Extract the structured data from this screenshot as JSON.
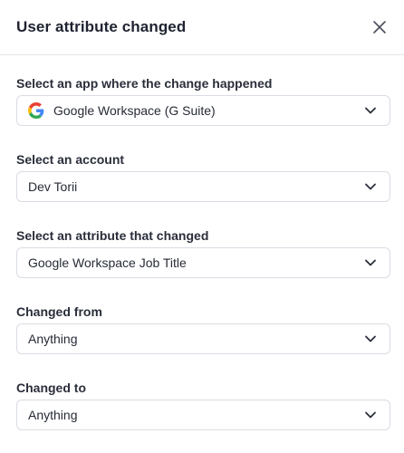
{
  "header": {
    "title": "User attribute changed",
    "close_icon": "close-icon"
  },
  "fields": [
    {
      "label": "Select an app where the change happened",
      "value": "Google Workspace (G Suite)",
      "icon": "google-logo-icon"
    },
    {
      "label": "Select an account",
      "value": "Dev Torii"
    },
    {
      "label": "Select an attribute that changed",
      "value": "Google Workspace Job Title"
    },
    {
      "label": "Changed from",
      "value": "Anything"
    },
    {
      "label": "Changed to",
      "value": "Anything"
    }
  ],
  "colors": {
    "border": "#d9dce3",
    "text": "#272b36",
    "google_blue": "#4285F4",
    "google_red": "#EA4335",
    "google_yellow": "#FBBC05",
    "google_green": "#34A853"
  }
}
